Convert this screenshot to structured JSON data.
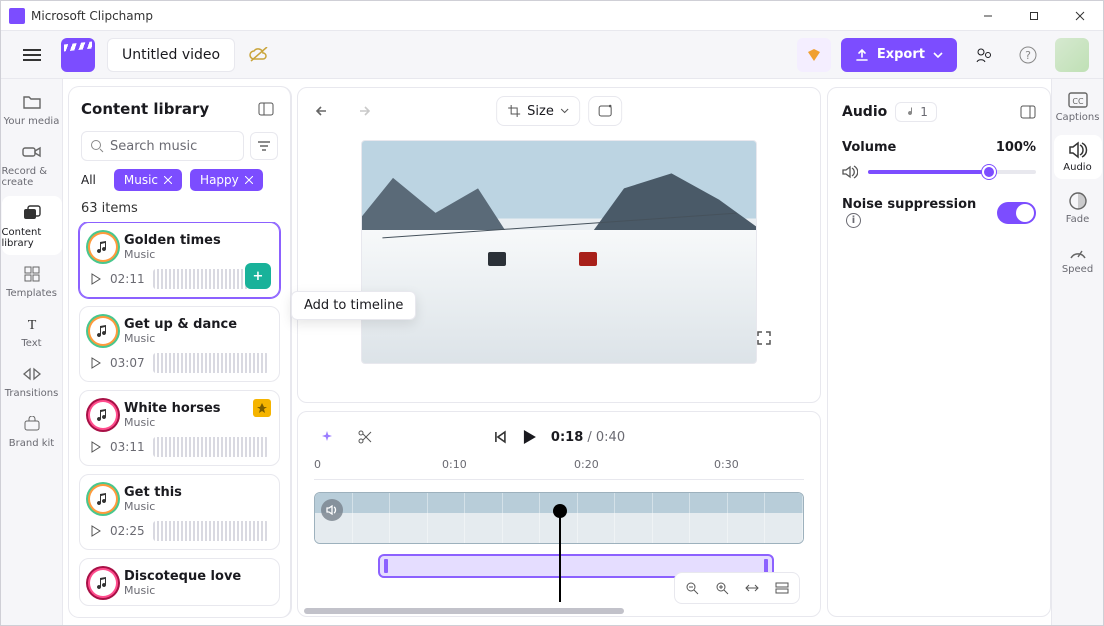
{
  "app": {
    "title": "Microsoft Clipchamp"
  },
  "project": {
    "title": "Untitled video"
  },
  "toolbar": {
    "export_label": "Export"
  },
  "rail": {
    "items": [
      {
        "label": "Your media"
      },
      {
        "label": "Record & create"
      },
      {
        "label": "Content library"
      },
      {
        "label": "Templates"
      },
      {
        "label": "Text"
      },
      {
        "label": "Transitions"
      },
      {
        "label": "Brand kit"
      }
    ]
  },
  "library": {
    "title": "Content library",
    "search_placeholder": "Search music",
    "filter_all": "All",
    "chip_music": "Music",
    "chip_happy": "Happy",
    "count_text": "63 items",
    "tracks": [
      {
        "title": "Golden times",
        "sub": "Music",
        "duration": "02:11",
        "selected": true,
        "badge": false,
        "icon": "rainbow"
      },
      {
        "title": "Get up & dance",
        "sub": "Music",
        "duration": "03:07",
        "selected": false,
        "badge": false,
        "icon": "rainbow"
      },
      {
        "title": "White horses",
        "sub": "Music",
        "duration": "03:11",
        "selected": false,
        "badge": true,
        "icon": "pink"
      },
      {
        "title": "Get this",
        "sub": "Music",
        "duration": "02:25",
        "selected": false,
        "badge": false,
        "icon": "rainbow"
      },
      {
        "title": "Discoteque love",
        "sub": "Music",
        "duration": "",
        "selected": false,
        "badge": false,
        "icon": "pink"
      }
    ]
  },
  "tooltip": {
    "add_to_timeline": "Add to timeline"
  },
  "stage": {
    "size_label": "Size"
  },
  "transport": {
    "current": "0:18",
    "total": "0:40",
    "ticks": [
      "0",
      "0:10",
      "0:20",
      "0:30"
    ]
  },
  "inspector": {
    "title": "Audio",
    "badge_count": "1",
    "volume_label": "Volume",
    "volume_value": "100%",
    "noise_label": "Noise suppression",
    "noise_on": true
  },
  "rrail": {
    "items": [
      {
        "label": "Captions"
      },
      {
        "label": "Audio"
      },
      {
        "label": "Fade"
      },
      {
        "label": "Speed"
      }
    ]
  }
}
